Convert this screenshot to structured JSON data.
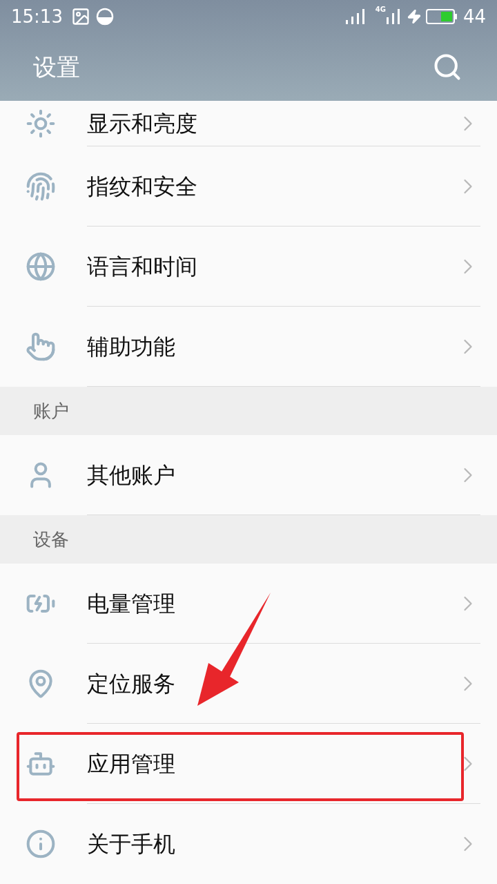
{
  "status_bar": {
    "time": "15:13",
    "network": "4G",
    "battery": "44"
  },
  "header": {
    "title": "设置"
  },
  "list": [
    {
      "kind": "row",
      "label": "显示和亮度",
      "highlighted": false
    },
    {
      "kind": "row",
      "label": "指纹和安全",
      "highlighted": false
    },
    {
      "kind": "row",
      "label": "语言和时间",
      "highlighted": false
    },
    {
      "kind": "row",
      "label": "辅助功能",
      "highlighted": false
    },
    {
      "kind": "section",
      "label": "账户"
    },
    {
      "kind": "row",
      "label": "其他账户",
      "highlighted": false
    },
    {
      "kind": "section",
      "label": "设备"
    },
    {
      "kind": "row",
      "label": "电量管理",
      "highlighted": false
    },
    {
      "kind": "row",
      "label": "定位服务",
      "highlighted": false
    },
    {
      "kind": "row",
      "label": "应用管理",
      "highlighted": true
    },
    {
      "kind": "row",
      "label": "关于手机",
      "highlighted": false
    }
  ],
  "annotation": {
    "arrow": true
  }
}
